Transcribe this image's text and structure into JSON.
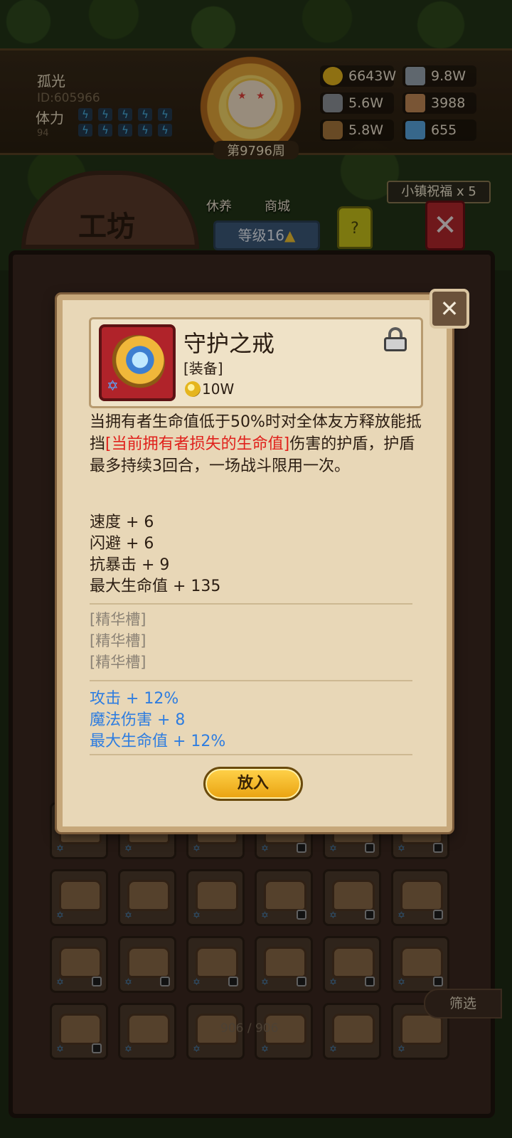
{
  "player": {
    "name": "孤光",
    "id": "ID:605966",
    "stamina_label": "体力",
    "stamina_value": "94",
    "week": "第9796周"
  },
  "resources": [
    {
      "value": "6643W",
      "icon": "gold-coin-icon",
      "color": "#e5b51e"
    },
    {
      "value": "9.8W",
      "icon": "iron-ingot-icon",
      "color": "#9aa6b2"
    },
    {
      "value": "5.6W",
      "icon": "stone-icon",
      "color": "#8f9499"
    },
    {
      "value": "3988",
      "icon": "leather-icon",
      "color": "#c48a56"
    },
    {
      "value": "5.8W",
      "icon": "wood-icon",
      "color": "#a8783c"
    },
    {
      "value": "655",
      "icon": "crystal-icon",
      "color": "#5aa6e0"
    }
  ],
  "nav": {
    "workshop": "工坊",
    "rest": "休养",
    "shop": "商城",
    "level": "等级16",
    "help": "?",
    "bless": "小镇祝福 x 5"
  },
  "dialog": {
    "item_name": "守护之戒",
    "item_type": "[装备]",
    "price": "10W",
    "description_pre": "当拥有者生命值低于50%时对全体友方释放能抵挡",
    "description_highlight": "[当前拥有者损失的生命值]",
    "description_post": "伤害的护盾，护盾最多持续3回合，一场战斗限用一次。",
    "stats": [
      "速度 + 6",
      "闪避 + 6",
      "抗暴击 + 9",
      "最大生命值 + 135"
    ],
    "essence_slots": [
      "[精华槽]",
      "[精华槽]",
      "[精华槽]"
    ],
    "bonuses": [
      "攻击 + 12%",
      "魔法伤害 + 8",
      "最大生命值 + 12%"
    ],
    "place_button": "放入"
  },
  "inventory": {
    "filter_label": "筛选",
    "count": "906 / 906"
  },
  "colors": {
    "highlight_red": "#e0201b",
    "bonus_blue": "#2e7de0",
    "button_gold": "#f2b928"
  }
}
